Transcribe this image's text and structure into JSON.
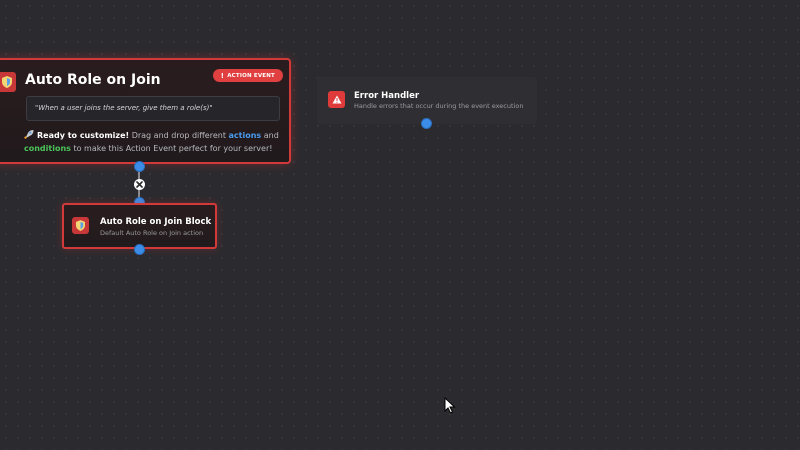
{
  "event_node": {
    "icon": "role-shield-icon",
    "title": "Auto Role on Join",
    "badge": {
      "icon": "exclamation-icon",
      "label": "ACTION EVENT"
    },
    "quote": "\"When a user joins the server, give them a role(s)\"",
    "description": {
      "icon": "rocket-icon",
      "lead": "Ready to customize!",
      "part1": " Drag and drop different ",
      "actions": "actions",
      "part2": " and ",
      "conditions": "conditions",
      "part3": " to make this Action Event perfect for your server!"
    }
  },
  "block_node": {
    "icon": "role-shield-icon",
    "title": "Auto Role on Join Block",
    "subtitle": "Default Auto Role on Join action"
  },
  "error_node": {
    "icon": "warning-triangle-icon",
    "title": "Error Handler",
    "subtitle": "Handle errors that occur during the event execution"
  },
  "colors": {
    "canvas_bg": "#2b2b2f",
    "accent_red": "#d23a3a",
    "handle_blue": "#3b8de8",
    "actions_blue": "#4a9bf0",
    "conditions_green": "#4cc35a"
  }
}
